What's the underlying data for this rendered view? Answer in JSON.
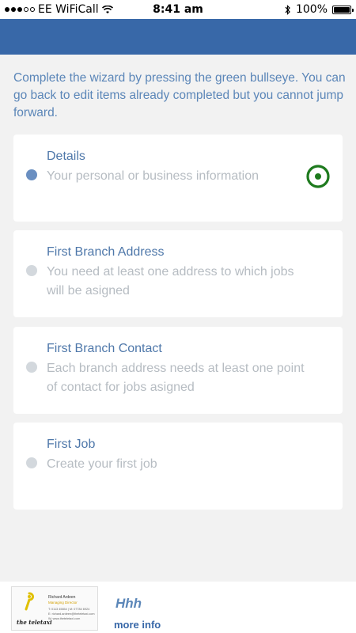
{
  "status_bar": {
    "carrier": "EE WiFiCall",
    "time": "8:41 am",
    "battery": "100%"
  },
  "intro_text": "Complete the wizard by pressing the green bullseye. You can go back to edit items already completed but you cannot jump forward.",
  "steps": [
    {
      "title": "Details",
      "description": "Your personal or business information",
      "status": "current"
    },
    {
      "title": "First Branch Address",
      "description": "You need at least one address to which jobs will be asigned",
      "status": "pending"
    },
    {
      "title": "First Branch Contact",
      "description": "Each branch address needs at least one point of contact for jobs asigned",
      "status": "pending"
    },
    {
      "title": "First Job",
      "description": "Create your first job",
      "status": "pending"
    }
  ],
  "footer": {
    "card": {
      "name": "Richard Ardeen",
      "role": "Managing Director",
      "line1": "T: 0113 45654 | M: 07784 6924",
      "line2": "E: richard.ardeen@theteletaxi.com",
      "line3": "W: www.theteletaxi.com",
      "logo_text": "the teletaxi"
    },
    "title": "Hhh",
    "more_info": "more info"
  },
  "colors": {
    "header": "#3868a8",
    "accent_text": "#5b86b8",
    "active_bullet": "#6a8fc1",
    "inactive_bullet": "#d3d8dd",
    "bullseye": "#1e7a1e"
  }
}
